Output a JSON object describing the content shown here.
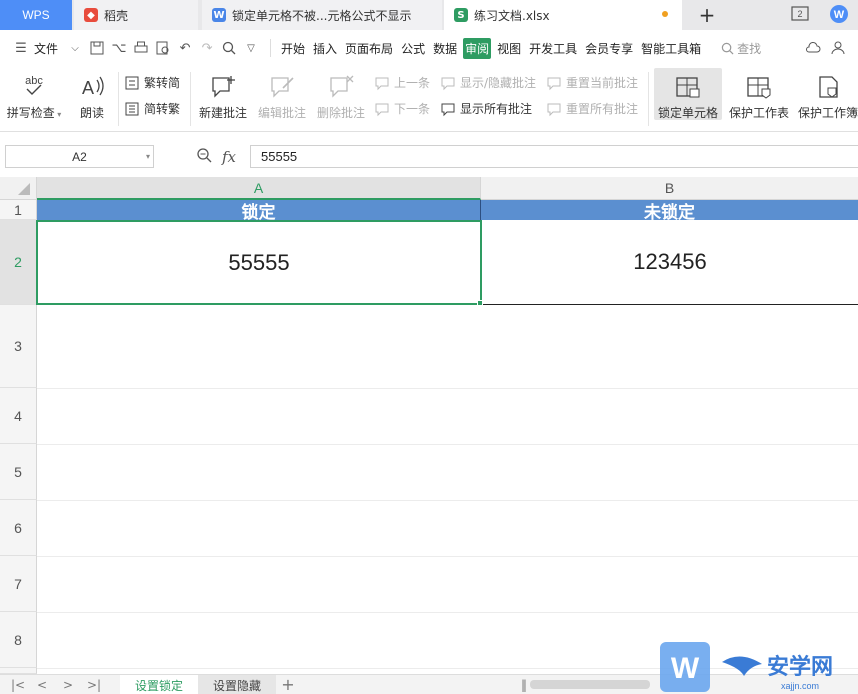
{
  "tabs": {
    "wps": "WPS",
    "docer": "稻壳",
    "doc2": "锁定单元格不被...元格公式不显示",
    "active": "练习文档.xlsx"
  },
  "window": {
    "badge": "2"
  },
  "menu": {
    "file": "文件",
    "items": [
      "开始",
      "插入",
      "页面布局",
      "公式",
      "数据",
      "审阅",
      "视图",
      "开发工具",
      "会员专享",
      "智能工具箱"
    ],
    "active_index": 5,
    "search": "查找"
  },
  "ribbon": {
    "spell_check": "拼写检查",
    "read_aloud": "朗读",
    "trad_to_simp": "繁转简",
    "simp_to_trad": "简转繁",
    "new_comment": "新建批注",
    "edit_comment": "编辑批注",
    "delete_comment": "删除批注",
    "prev": "上一条",
    "next": "下一条",
    "show_hide_comment": "显示/隐藏批注",
    "show_all_comments": "显示所有批注",
    "reset_current": "重置当前批注",
    "reset_all": "重置所有批注",
    "lock_cell": "锁定单元格",
    "protect_sheet": "保护工作表",
    "protect_book": "保护工作簿",
    "abc_label": "abc"
  },
  "formula_bar": {
    "name_box": "A2",
    "fx": "fx",
    "value": "55555"
  },
  "grid": {
    "columns": [
      "A",
      "B"
    ],
    "rows": [
      "1",
      "2",
      "3",
      "4",
      "5",
      "6",
      "7",
      "8"
    ],
    "cells": {
      "A1": "锁定",
      "B1": "未锁定",
      "A2": "55555",
      "B2": "123456"
    },
    "header_fill": "#5b8fd0",
    "selection_color": "#2e9c62"
  },
  "sheets": [
    {
      "name": "设置锁定",
      "active": true
    },
    {
      "name": "设置隐藏",
      "active": false
    }
  ],
  "watermark": {
    "brand": "安学网",
    "url": "xajjn.com",
    "letter": "W"
  }
}
